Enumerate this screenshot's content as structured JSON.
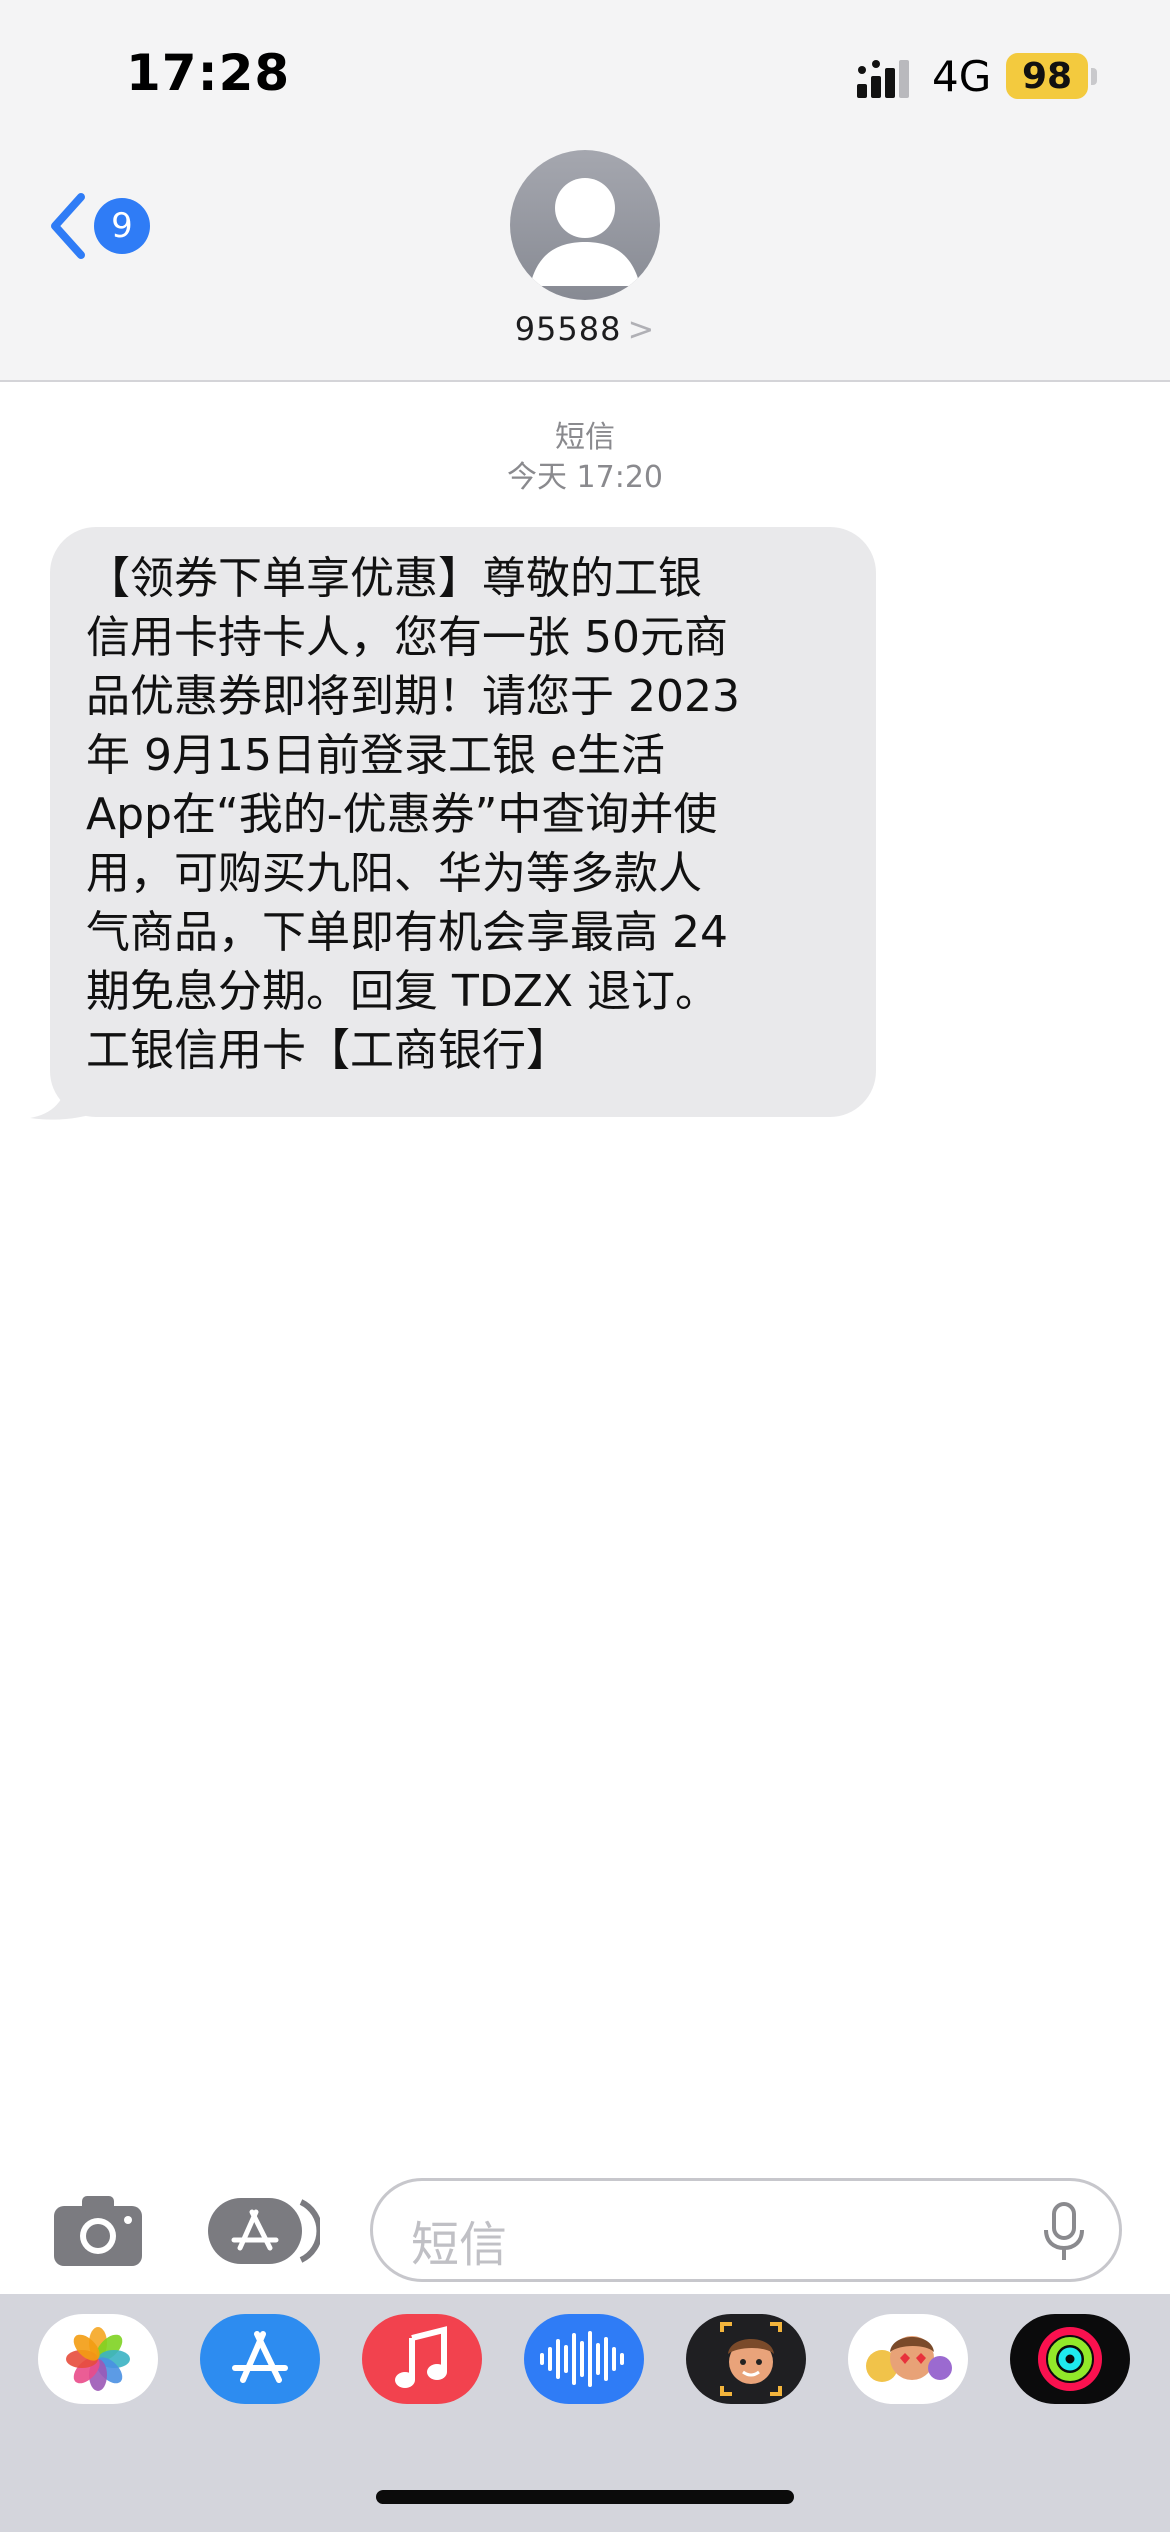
{
  "status_bar": {
    "time": "17:28",
    "network": "4G",
    "battery": "98"
  },
  "header": {
    "back_badge": "9",
    "contact_name": "95588",
    "contact_chevron": ">"
  },
  "thread": {
    "service": "短信",
    "timestamp": "今天 17:20",
    "message_lines": [
      "【领券下单享优惠】尊敬的工银",
      "信用卡持卡人，您有一张 50元商",
      "品优惠券即将到期！请您于 2023",
      "年 9月15日前登录工银 e生活",
      "App在“我的-优惠券”中查询并使",
      "用，可购买九阳、华为等多款人",
      "气商品，下单即有机会享最高 24",
      "期免息分期。回复 TDZX 退订。",
      "工银信用卡【工商银行】"
    ]
  },
  "input": {
    "placeholder": "短信"
  },
  "icons": {
    "back": "chevron-left-icon",
    "camera": "camera-icon",
    "apps": "app-store-icon",
    "mic": "microphone-icon"
  },
  "app_drawer": [
    "photos",
    "app-store",
    "music",
    "audio-message",
    "memoji",
    "memoji-stickers",
    "activity"
  ],
  "colors": {
    "accent": "#2f7cf6",
    "bubble": "#e9e9eb",
    "battery": "#f3ca3e",
    "music": "#f2424e"
  }
}
